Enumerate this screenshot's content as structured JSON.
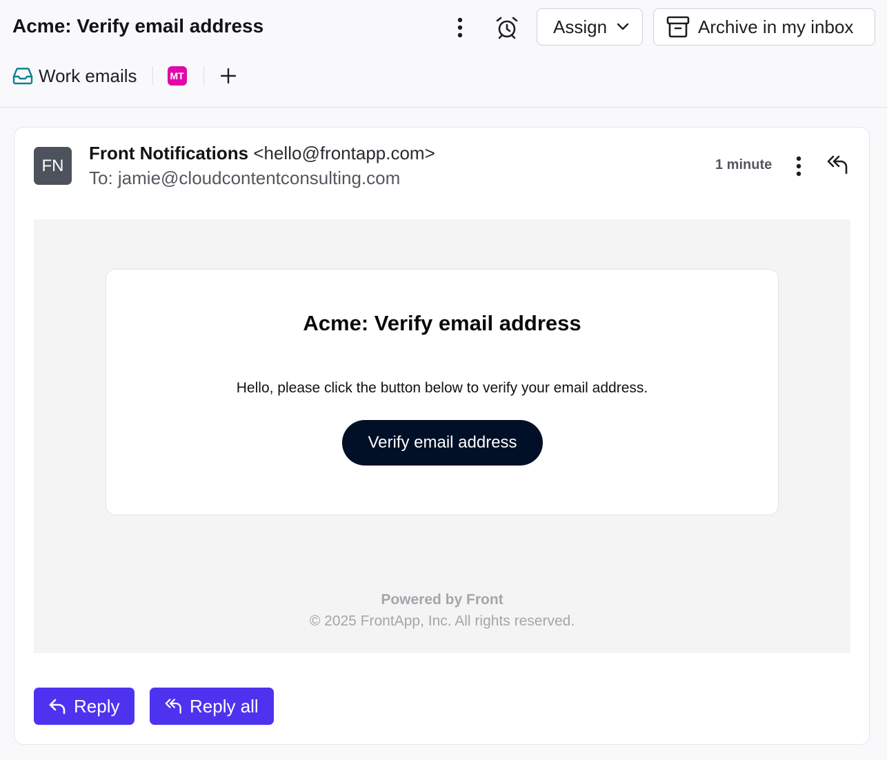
{
  "header": {
    "title": "Acme: Verify email address",
    "assign_label": "Assign",
    "archive_label": "Archive in my inbox",
    "inbox_tag": "Work emails",
    "assignee_initials": "MT"
  },
  "message": {
    "sender_initials": "FN",
    "sender_name": "Front Notifications",
    "sender_email": "<hello@frontapp.com>",
    "to": "To: jamie@cloudcontentconsulting.com",
    "time": "1 minute"
  },
  "email": {
    "title": "Acme: Verify email address",
    "body": "Hello, please click the button below to verify your email address.",
    "cta": "Verify email address",
    "powered_by": "Powered by Front",
    "copyright": "© 2025 FrontApp, Inc. All rights reserved."
  },
  "actions": {
    "reply": "Reply",
    "reply_all": "Reply all"
  },
  "colors": {
    "primary": "#4d33f0",
    "cta": "#021027",
    "assignee_badge": "#e10aa8",
    "inbox_icon": "#0f7f94"
  },
  "icons": {
    "more": "more-vertical-icon",
    "snooze": "alarm-clock-icon",
    "assign_dropdown": "chevron-down-icon",
    "archive": "archive-box-icon",
    "inbox": "inbox-tray-icon",
    "add": "plus-icon",
    "reply": "reply-arrow-icon",
    "reply_all": "reply-all-arrow-icon"
  }
}
